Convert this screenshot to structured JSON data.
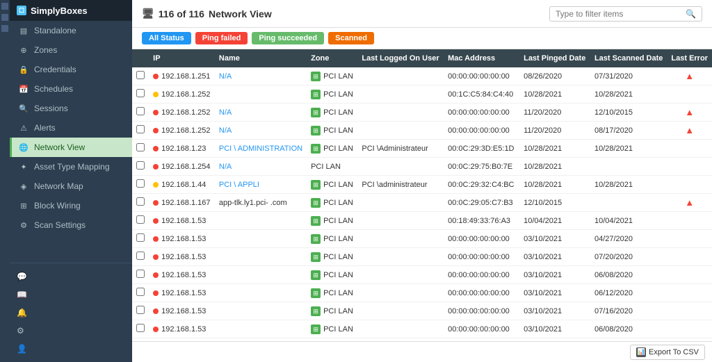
{
  "app": {
    "title": "SimplyBoxes",
    "title_icon": "☐"
  },
  "header": {
    "count": "116 of 116",
    "view_label": "Network View",
    "filter_placeholder": "Type to filter items"
  },
  "filter_buttons": [
    {
      "id": "all",
      "label": "All Status",
      "class": "all"
    },
    {
      "id": "ping-failed",
      "label": "Ping failed",
      "class": "ping-failed"
    },
    {
      "id": "ping-succeeded",
      "label": "Ping succeeded",
      "class": "ping-succeeded"
    },
    {
      "id": "scanned",
      "label": "Scanned",
      "class": "scanned"
    }
  ],
  "sidebar": {
    "items": [
      {
        "id": "standalone",
        "label": "Standalone",
        "icon": "▤"
      },
      {
        "id": "zones",
        "label": "Zones",
        "icon": "⊕"
      },
      {
        "id": "credentials",
        "label": "Credentials",
        "icon": "🔒"
      },
      {
        "id": "schedules",
        "label": "Schedules",
        "icon": "📅"
      },
      {
        "id": "sessions",
        "label": "Sessions",
        "icon": "🔍"
      },
      {
        "id": "alerts",
        "label": "Alerts",
        "icon": "⚠"
      },
      {
        "id": "network-view",
        "label": "Network View",
        "icon": "🌐",
        "active": true
      },
      {
        "id": "asset-type-mapping",
        "label": "Asset Type Mapping",
        "icon": "✦"
      },
      {
        "id": "network-map",
        "label": "Network Map",
        "icon": "◈"
      },
      {
        "id": "block-wiring",
        "label": "Block Wiring",
        "icon": "⊞"
      },
      {
        "id": "scan-settings",
        "label": "Scan Settings",
        "icon": "⚙"
      }
    ],
    "bottom_items": [
      {
        "id": "chat",
        "icon": "💬"
      },
      {
        "id": "book",
        "icon": "📖"
      },
      {
        "id": "bell",
        "icon": "🔔"
      },
      {
        "id": "alert",
        "icon": "⚠"
      },
      {
        "id": "settings",
        "icon": "⚙"
      },
      {
        "id": "user",
        "icon": "👤"
      }
    ]
  },
  "table": {
    "columns": [
      "",
      "IP",
      "Name",
      "Zone",
      "Last Logged On User",
      "Mac Address",
      "Last Pinged Date",
      "Last Scanned Date",
      "Last Error"
    ],
    "rows": [
      {
        "dot": "red",
        "ip": "192.168.1.251",
        "name": "N/A",
        "name_link": true,
        "zone_icon": true,
        "zone": "PCI LAN",
        "logged": "",
        "mac": "00:00:00:00:00:00",
        "pinged": "08/26/2020",
        "scanned": "07/31/2020",
        "error": true
      },
      {
        "dot": "yellow",
        "ip": "192.168.1.252",
        "name": "",
        "name_link": false,
        "zone_icon": true,
        "zone": "PCI LAN",
        "logged": "",
        "mac": "00:1C:C5:84:C4:40",
        "pinged": "10/28/2021",
        "scanned": "10/28/2021",
        "error": false
      },
      {
        "dot": "red",
        "ip": "192.168.1.252",
        "name": "N/A",
        "name_link": true,
        "zone_icon": true,
        "zone": "PCI LAN",
        "logged": "",
        "mac": "00:00:00:00:00:00",
        "pinged": "11/20/2020",
        "scanned": "12/10/2015",
        "error": true
      },
      {
        "dot": "red",
        "ip": "192.168.1.252",
        "name": "N/A",
        "name_link": true,
        "zone_icon": true,
        "zone": "PCI LAN",
        "logged": "",
        "mac": "00:00:00:00:00:00",
        "pinged": "11/20/2020",
        "scanned": "08/17/2020",
        "error": true
      },
      {
        "dot": "red",
        "ip": "192.168.1.23",
        "name": "PCI    \\ ADMINISTRATION",
        "name_link": true,
        "zone_icon": true,
        "zone": "PCI LAN",
        "logged": "PCI   \\Administrateur",
        "mac": "00:0C:29:3D:E5:1D",
        "pinged": "10/28/2021",
        "scanned": "10/28/2021",
        "error": false
      },
      {
        "dot": "red",
        "ip": "192.168.1.254",
        "name": "N/A",
        "name_link": true,
        "zone_icon": false,
        "zone": "PCI LAN",
        "logged": "",
        "mac": "00:0C:29:75:B0:7E",
        "pinged": "10/28/2021",
        "scanned": "",
        "error": false
      },
      {
        "dot": "yellow",
        "ip": "192.168.1.44",
        "name": "PCI    \\ APPLI",
        "name_link": true,
        "zone_icon": true,
        "zone": "PCI LAN",
        "logged": "PCI   \\administrateur",
        "mac": "00:0C:29:32:C4:BC",
        "pinged": "10/28/2021",
        "scanned": "10/28/2021",
        "error": false
      },
      {
        "dot": "red",
        "ip": "192.168.1.167",
        "name": "app-tlk.ly1.pci-     .com",
        "name_link": false,
        "zone_icon": true,
        "zone": "PCI LAN",
        "logged": "",
        "mac": "00:0C:29:05:C7:B3",
        "pinged": "12/10/2015",
        "scanned": "",
        "error": true
      },
      {
        "dot": "red",
        "ip": "192.168.1.53",
        "name": "",
        "name_link": false,
        "zone_icon": true,
        "zone": "PCI LAN",
        "logged": "",
        "mac": "00:18:49:33:76:A3",
        "pinged": "10/04/2021",
        "scanned": "10/04/2021",
        "error": false
      },
      {
        "dot": "red",
        "ip": "192.168.1.53",
        "name": "",
        "name_link": false,
        "zone_icon": true,
        "zone": "PCI LAN",
        "logged": "",
        "mac": "00:00:00:00:00:00",
        "pinged": "03/10/2021",
        "scanned": "04/27/2020",
        "error": false
      },
      {
        "dot": "red",
        "ip": "192.168.1.53",
        "name": "",
        "name_link": false,
        "zone_icon": true,
        "zone": "PCI LAN",
        "logged": "",
        "mac": "00:00:00:00:00:00",
        "pinged": "03/10/2021",
        "scanned": "07/20/2020",
        "error": false
      },
      {
        "dot": "red",
        "ip": "192.168.1.53",
        "name": "",
        "name_link": false,
        "zone_icon": true,
        "zone": "PCI LAN",
        "logged": "",
        "mac": "00:00:00:00:00:00",
        "pinged": "03/10/2021",
        "scanned": "06/08/2020",
        "error": false
      },
      {
        "dot": "red",
        "ip": "192.168.1.53",
        "name": "",
        "name_link": false,
        "zone_icon": true,
        "zone": "PCI LAN",
        "logged": "",
        "mac": "00:00:00:00:00:00",
        "pinged": "03/10/2021",
        "scanned": "06/12/2020",
        "error": false
      },
      {
        "dot": "red",
        "ip": "192.168.1.53",
        "name": "",
        "name_link": false,
        "zone_icon": true,
        "zone": "PCI LAN",
        "logged": "",
        "mac": "00:00:00:00:00:00",
        "pinged": "03/10/2021",
        "scanned": "07/16/2020",
        "error": false
      },
      {
        "dot": "red",
        "ip": "192.168.1.53",
        "name": "",
        "name_link": false,
        "zone_icon": true,
        "zone": "PCI LAN",
        "logged": "",
        "mac": "00:00:00:00:00:00",
        "pinged": "03/10/2021",
        "scanned": "06/08/2020",
        "error": false
      }
    ]
  },
  "export": {
    "label": "Export To CSV",
    "icon": "📊"
  },
  "colors": {
    "sidebar_bg": "#2c3e50",
    "active_bg": "#c8e6c9",
    "active_text": "#1b5e20",
    "header_bg": "#37474f",
    "accent_blue": "#2196f3"
  }
}
